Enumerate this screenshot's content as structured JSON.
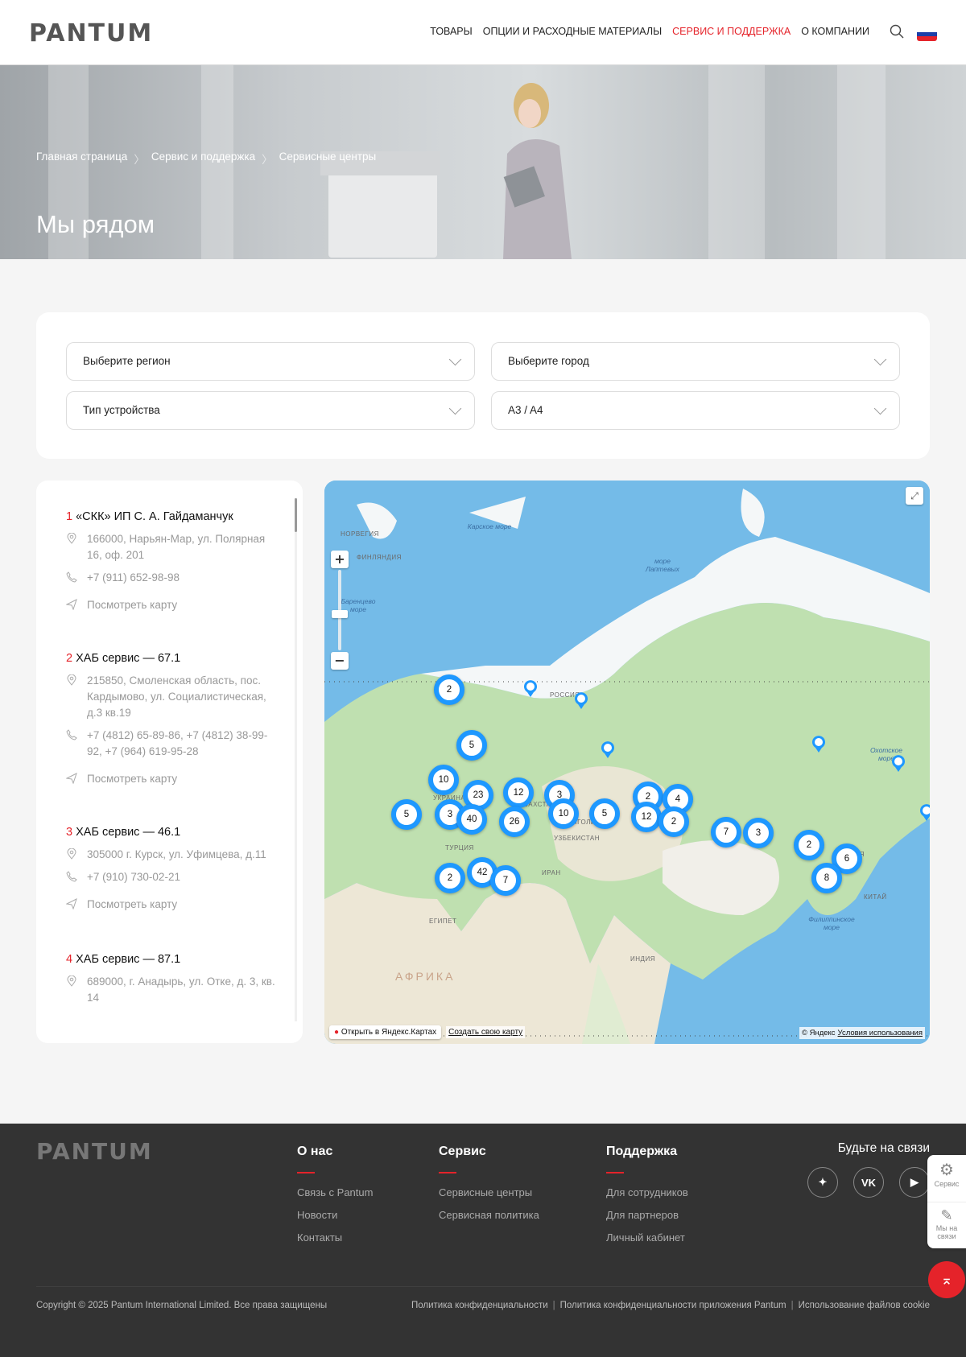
{
  "header": {
    "logo": "PANTUM",
    "nav": [
      "ТОВАРЫ",
      "ОПЦИИ И РАСХОДНЫЕ МАТЕРИАЛЫ",
      "СЕРВИС И ПОДДЕРЖКА",
      "О КОМПАНИИ"
    ],
    "active_nav": "СЕРВИС И ПОДДЕРЖКА"
  },
  "hero": {
    "breadcrumb": [
      "Главная страница",
      "Сервис и поддержка",
      "Сервисные центры"
    ],
    "title": "Мы рядом"
  },
  "filters": {
    "region": "Выберите регион",
    "city": "Выберите город",
    "device_type": "Тип устройства",
    "format": "A3 / A4"
  },
  "centers": [
    {
      "num": "1",
      "name": "«СКК» ИП С. А. Гайдаманчук",
      "address": "166000, Нарьян-Мар, ул. Полярная 16, оф. 201",
      "phone": "+7 (911) 652-98-98",
      "map_link": "Посмотреть карту"
    },
    {
      "num": "2",
      "name": "ХАБ сервис — 67.1",
      "address": "215850, Смоленская область, пос. Кардымово, ул. Социалистическая, д.3 кв.19",
      "phone": "+7 (4812) 65-89-86, +7 (4812) 38-99-92, +7 (964) 619-95-28",
      "map_link": "Посмотреть карту"
    },
    {
      "num": "3",
      "name": "ХАБ сервис — 46.1",
      "address": "305000 г. Курск, ул. Уфимцева, д.11",
      "phone": "+7 (910) 730-02-21",
      "map_link": "Посмотреть карту"
    },
    {
      "num": "4",
      "name": "ХАБ сервис — 87.1",
      "address": "689000, г. Анадырь, ул. Отке, д. 3, кв. 14"
    }
  ],
  "map": {
    "clusters": [
      "2",
      "5",
      "10",
      "23",
      "12",
      "3",
      "10",
      "5",
      "2",
      "4",
      "12",
      "2",
      "5",
      "3",
      "40",
      "26",
      "7",
      "3",
      "2",
      "6",
      "8",
      "2",
      "42",
      "7"
    ],
    "seas": [
      "Карское море",
      "море Лаптевых",
      "Баренцево море",
      "Охотское море",
      "Филиппинское море"
    ],
    "countries": [
      "РОССИЯ",
      "КАЗАХСТАН",
      "МОНГОЛИЯ",
      "НОРВЕГИЯ",
      "ФИНЛЯНДИЯ",
      "УКРАИНА",
      "ТУРЦИЯ",
      "ИРАН",
      "КИТАЙ",
      "ИНДИЯ",
      "ЕГИПЕТ",
      "АФРИКА",
      "ЯПОНИЯ",
      "УЗБЕКИСТАН"
    ],
    "open_yandex": "Открыть в Яндекс.Картах",
    "create_map": "Создать свою карту",
    "copyright": "© Яндекс",
    "terms": "Условия использования",
    "accent": "#1e98ff"
  },
  "footer": {
    "logo": "PANTUM",
    "columns": [
      {
        "title": "О нас",
        "links": [
          "Связь с Pantum",
          "Новости",
          "Контакты"
        ]
      },
      {
        "title": "Сервис",
        "links": [
          "Сервисные центры",
          "Сервисная политика"
        ]
      },
      {
        "title": "Поддержка",
        "links": [
          "Для сотрудников",
          "Для партнеров",
          "Личный кабинет"
        ]
      }
    ],
    "stay": "Будьте на связи",
    "social": [
      "✦",
      "VK",
      "▶"
    ],
    "copyright": "Copyright © 2025 Pantum International Limited. Все права защищены",
    "legal": [
      "Политика конфиденциальности",
      "Политика конфиденциальности приложения Pantum",
      "Использование файлов cookie"
    ]
  },
  "widget": {
    "service": "Сервис",
    "contact": "Мы на связи"
  },
  "colors": {
    "brand_red": "#e5232a",
    "footer_bg": "#333333"
  }
}
